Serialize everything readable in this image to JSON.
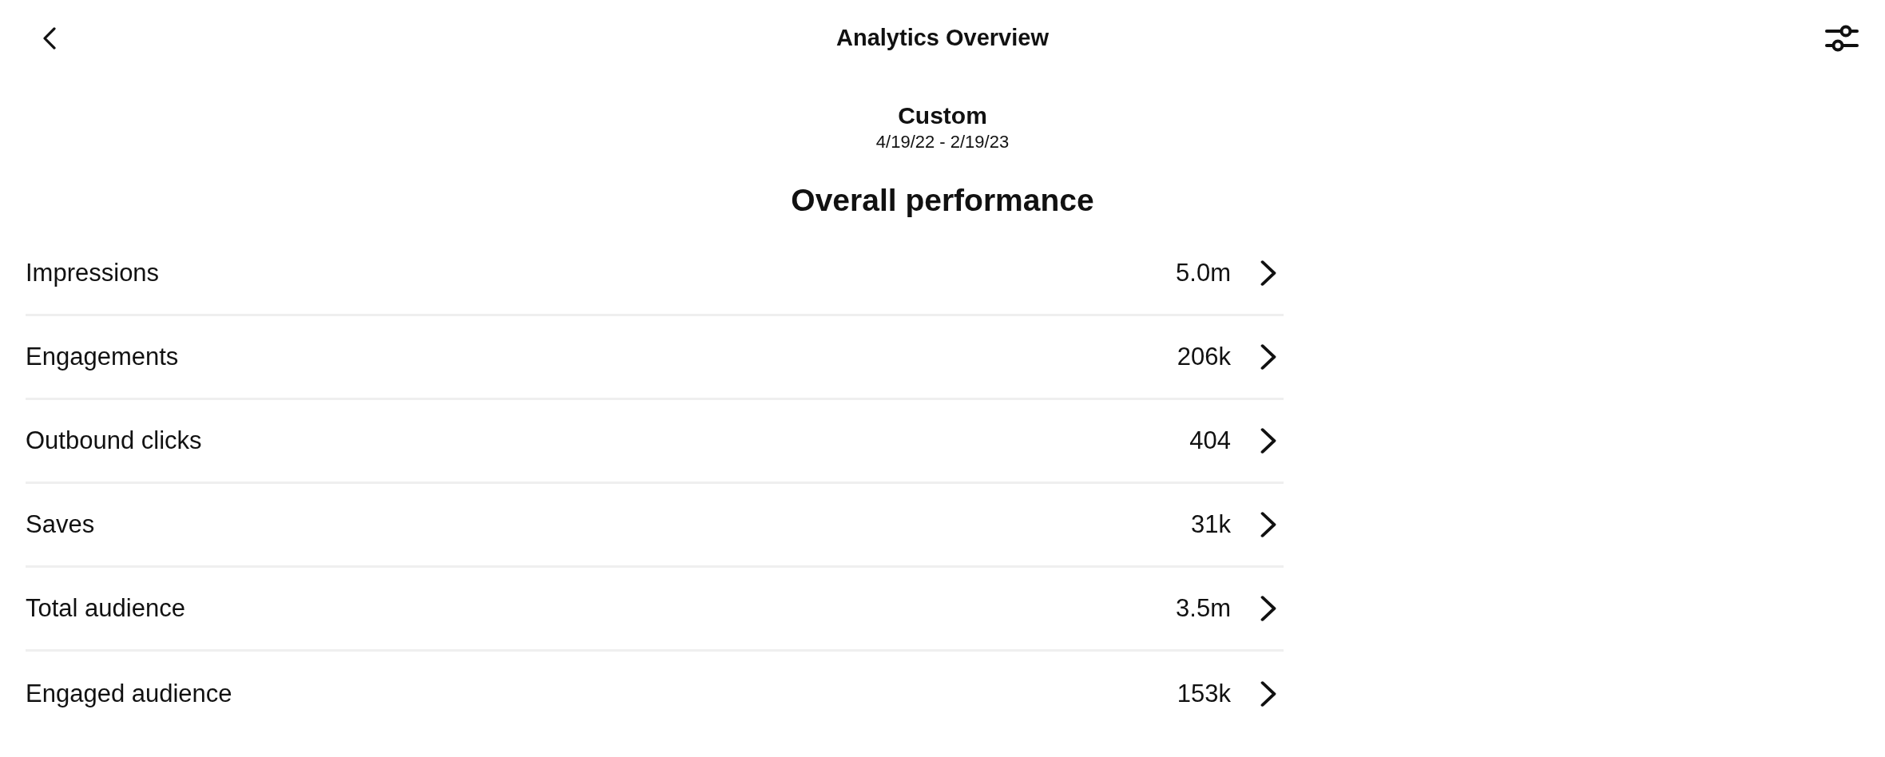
{
  "header": {
    "title": "Analytics Overview"
  },
  "date_range": {
    "label": "Custom",
    "range": "4/19/22 - 2/19/23"
  },
  "section": {
    "title": "Overall performance"
  },
  "metrics": [
    {
      "label": "Impressions",
      "value": "5.0m"
    },
    {
      "label": "Engagements",
      "value": "206k"
    },
    {
      "label": "Outbound clicks",
      "value": "404"
    },
    {
      "label": "Saves",
      "value": "31k"
    },
    {
      "label": "Total audience",
      "value": "3.5m"
    },
    {
      "label": "Engaged audience",
      "value": "153k"
    }
  ]
}
